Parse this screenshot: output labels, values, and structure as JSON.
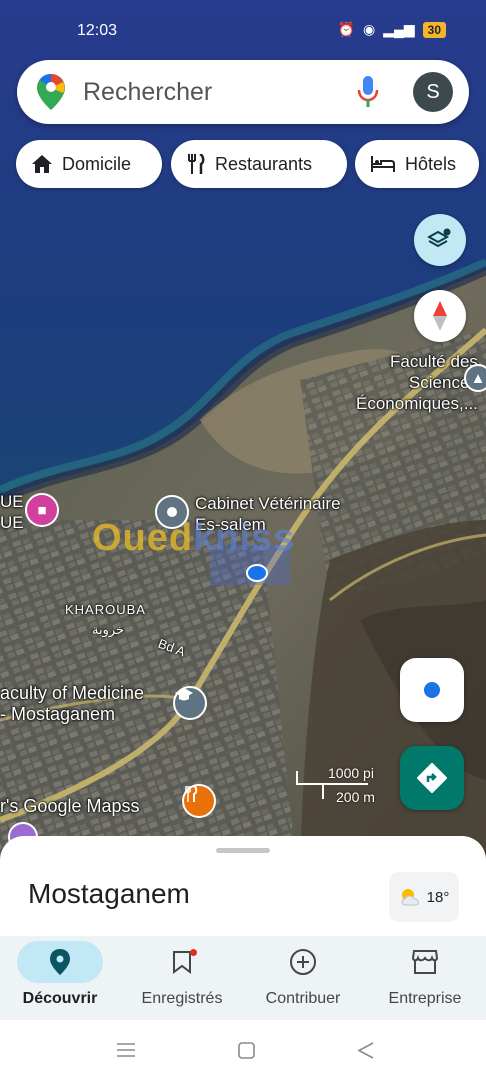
{
  "status_bar": {
    "time": "12:03",
    "battery": "30"
  },
  "search": {
    "placeholder": "Rechercher",
    "avatar_letter": "S"
  },
  "chips": [
    {
      "label": "Domicile",
      "icon": "home-icon"
    },
    {
      "label": "Restaurants",
      "icon": "restaurant-icon"
    },
    {
      "label": "Hôtels",
      "icon": "hotel-icon"
    }
  ],
  "map": {
    "places": {
      "faculte": "Faculté des\nSciences\nÉconomiques,...",
      "cabinet": "Cabinet Vétérinaire\nEs-salem",
      "faculty_medicine": "aculty of Medicine\n- Mostaganem",
      "left_edge": "UE\nUE",
      "kharouba": "KHAROUBA",
      "kharouba_ar": "خروبة",
      "road": "Bd A",
      "google": "r's Google Mapss"
    },
    "watermark": {
      "part1": "Oued",
      "part2": "kniss"
    },
    "scale": {
      "imperial": "1000 pi",
      "metric": "200 m"
    }
  },
  "sheet": {
    "title": "Mostaganem",
    "temperature": "18°"
  },
  "nav": {
    "items": [
      {
        "label": "Découvrir",
        "icon": "explore-pin-icon",
        "active": true
      },
      {
        "label": "Enregistrés",
        "icon": "bookmark-icon"
      },
      {
        "label": "Contribuer",
        "icon": "add-circle-icon"
      },
      {
        "label": "Entreprise",
        "icon": "storefront-icon"
      }
    ]
  },
  "colors": {
    "accent": "#0b5563",
    "directions": "#00796b",
    "active_pill": "#c2e7f5",
    "location": "#1a73e8"
  }
}
